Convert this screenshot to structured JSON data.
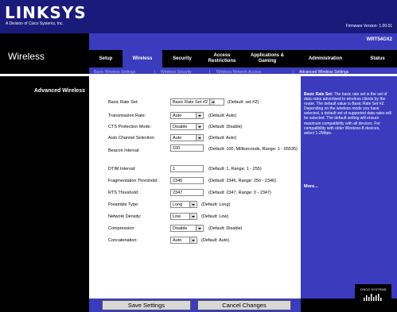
{
  "header": {
    "logo": "LINKSYS",
    "logo_sub": "A Division of Cisco Systems, Inc.",
    "firmware": "Firmware Version: 1.00.01",
    "model": "WRT54GX2"
  },
  "section_title": "Wireless",
  "tabs": [
    {
      "label": "Setup"
    },
    {
      "label": "Wireless"
    },
    {
      "label": "Security"
    },
    {
      "label": "Access Restrictions"
    },
    {
      "label": "Applications & Gaming"
    },
    {
      "label": "Administration"
    },
    {
      "label": "Status"
    }
  ],
  "subtabs": [
    {
      "label": "Basic Wireless Settings"
    },
    {
      "label": "Wireless Security"
    },
    {
      "label": "Wireless Network Access"
    },
    {
      "label": "Advanced Wireless Settings"
    }
  ],
  "sidebar": {
    "title": "Advanced Wireless"
  },
  "form": {
    "rows": [
      {
        "label": "Basic Rate Set:",
        "value": "Basic Rate Set #2",
        "default": "(Default: set #2)"
      },
      {
        "label": "Transmission Rate:",
        "value": "Auto",
        "default": "(Default: Auto)"
      },
      {
        "label": "CTS Protection Mode:",
        "value": "Disable",
        "default": "(Default: Disable)"
      },
      {
        "label": "Auto Channel Selection:",
        "value": "Auto",
        "default": "(Default: Auto)"
      },
      {
        "label": "Beacon Interval:",
        "value": "100",
        "default": "(Default: 100, Milliseconds, Range: 1 - 65535)"
      },
      {
        "label": "DTIM Interval:",
        "value": "1",
        "default": "(Default: 1, Range: 1 - 255)"
      },
      {
        "label": "Fragmentation Threshold:",
        "value": "2346",
        "default": "(Default: 2346, Range: 256 - 2346)"
      },
      {
        "label": "RTS Threshold:",
        "value": "2347",
        "default": "(Default: 2347, Range: 0 - 2347)"
      },
      {
        "label": "Preamble Type:",
        "value": "Long",
        "default": "(Default: Long)"
      },
      {
        "label": "Network Density:",
        "value": "Low",
        "default": "(Default: Low)"
      },
      {
        "label": "Compression:",
        "value": "Disable",
        "default": "(Default: Disable)"
      },
      {
        "label": "Concatenation:",
        "value": "Auto",
        "default": "(Default: Auto)"
      }
    ]
  },
  "help": {
    "title": "Basic Rate Set:",
    "text": "The basic rate set is the set of data rates advertised to wireless clients by the router. The default value is Basic Rate Set #2. Depending on the wireless mode you have selected, a default set of supported data rates will be selected. The default setting will ensure maximum compatibility with all devices. For compatibility with older Wireless-B devices, select 1-2Mbps.",
    "more": "More..."
  },
  "buttons": {
    "save": "Save Settings",
    "cancel": "Cancel Changes"
  },
  "cisco_logo": "CISCO SYSTEMS",
  "colors": {
    "navy": "#1a1a7a",
    "blue": "#3b3bbd",
    "black": "#000000"
  }
}
